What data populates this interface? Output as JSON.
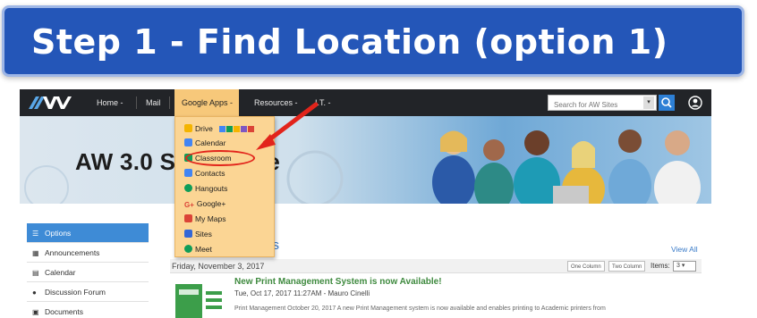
{
  "slide": {
    "title": "Step 1 - Find Location (option 1)"
  },
  "navbar": {
    "items": [
      "Home -",
      "Mail",
      "Google Apps -",
      "Resources -",
      "I.T. -"
    ],
    "active_index": 2,
    "search_placeholder": "Search for AW Sites",
    "logo_text": "AW"
  },
  "hero": {
    "title": "AW 3.0 Su",
    "title_tail": "e"
  },
  "dropdown": {
    "items": [
      "Drive",
      "Calendar",
      "Classroom",
      "Contacts",
      "Hangouts",
      "Google+",
      "My Maps",
      "Sites",
      "Meet"
    ],
    "highlighted": "Classroom"
  },
  "sidebar": {
    "items": [
      "Options",
      "Announcements",
      "Calendar",
      "Discussion Forum",
      "Documents"
    ]
  },
  "main": {
    "section_title": "nts",
    "view_all": "View All",
    "date": "Friday, November 3, 2017",
    "one_column": "One Column",
    "two_column": "Two Column",
    "items_label": "Items:",
    "items_value": "3",
    "news_title": "New Print Management System is now Available!",
    "news_meta": "Tue, Oct 17, 2017 11:27AM - Mauro Cinelli",
    "news_body": "Print Management October 20, 2017 A new Print Management system is now available and enables printing to Academic printers from"
  },
  "colors": {
    "banner": "#2456b8",
    "navbar": "#222428",
    "active_tab": "#f7c87a",
    "dropdown": "#fbd594",
    "annotation": "#e2241b",
    "sidebar_head": "#3e8bd6",
    "link": "#3a7bc8",
    "news_title": "#3f8a3f"
  }
}
